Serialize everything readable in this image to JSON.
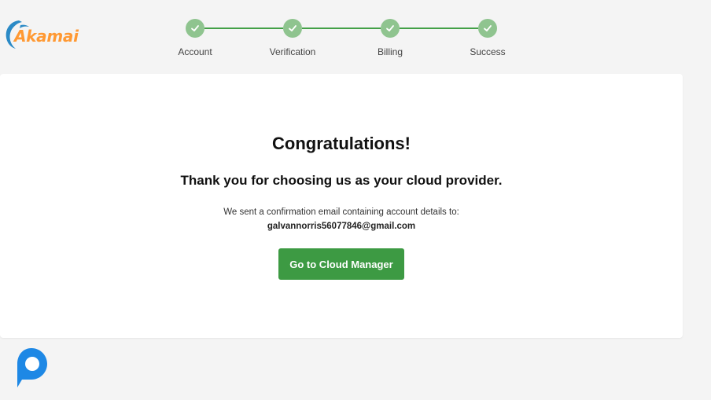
{
  "brand": {
    "name": "Akamai",
    "color": "#ff9933",
    "icon": "akamai-swoosh-icon"
  },
  "stepper": {
    "color_line": "#43a047",
    "color_circle": "#8fc48f",
    "steps": [
      {
        "label": "Account",
        "complete": true,
        "icon": "check-icon"
      },
      {
        "label": "Verification",
        "complete": true,
        "icon": "check-icon"
      },
      {
        "label": "Billing",
        "complete": true,
        "icon": "check-icon"
      },
      {
        "label": "Success",
        "complete": true,
        "icon": "check-icon"
      }
    ]
  },
  "card": {
    "title": "Congratulations!",
    "subtitle": "Thank you for choosing us as your cloud provider.",
    "note": "We sent a confirmation email containing account details to:",
    "email": "galvannorris56077846@gmail.com",
    "button_label": "Go to Cloud Manager",
    "button_color": "#3d9a43"
  },
  "chat_widget": {
    "icon": "chat-bubble-icon",
    "color": "#1e88e5"
  }
}
